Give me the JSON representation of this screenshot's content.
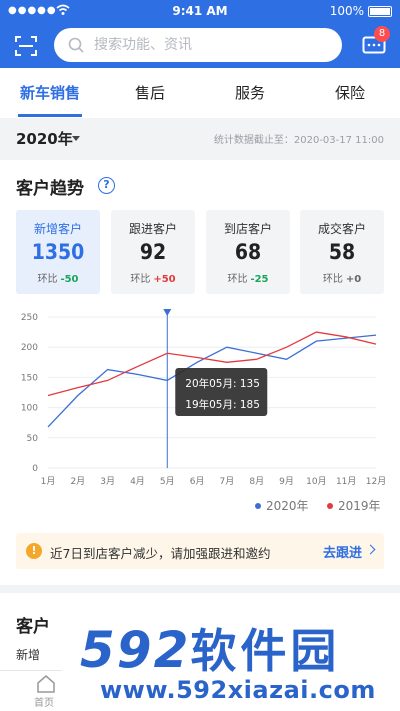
{
  "status_bar": {
    "carrier": "●●●●●",
    "time": "9:41 AM",
    "battery": "100%"
  },
  "header": {
    "search_placeholder": "搜索功能、资讯",
    "message_badge": "8"
  },
  "tabs": [
    {
      "label": "新车销售",
      "active": true
    },
    {
      "label": "售后",
      "active": false
    },
    {
      "label": "服务",
      "active": false
    },
    {
      "label": "保险",
      "active": false
    }
  ],
  "filter": {
    "year": "2020年",
    "stat_date": "统计数据截止至：2020-03-17 11:00"
  },
  "trend": {
    "title": "客户趋势",
    "help": "?",
    "kpis": [
      {
        "label": "新增客户",
        "value": "1350",
        "ratio_label": "环比",
        "delta": "-50",
        "delta_color": "green",
        "active": true
      },
      {
        "label": "跟进客户",
        "value": "92",
        "ratio_label": "环比",
        "delta": "+50",
        "delta_color": "red",
        "active": false
      },
      {
        "label": "到店客户",
        "value": "68",
        "ratio_label": "环比",
        "delta": "-25",
        "delta_color": "green",
        "active": false
      },
      {
        "label": "成交客户",
        "value": "58",
        "ratio_label": "环比",
        "delta": "+0",
        "delta_color": "gray",
        "active": false
      }
    ]
  },
  "chart_data": {
    "type": "line",
    "categories": [
      "1月",
      "2月",
      "3月",
      "4月",
      "5月",
      "6月",
      "7月",
      "8月",
      "9月",
      "10月",
      "11月",
      "12月"
    ],
    "ylim": [
      0,
      250
    ],
    "yticks": [
      0,
      50,
      100,
      150,
      200,
      250
    ],
    "series": [
      {
        "name": "2020年",
        "color": "#3b6fd6",
        "values": [
          68,
          120,
          163,
          155,
          145,
          175,
          200,
          190,
          180,
          210,
          215,
          220
        ]
      },
      {
        "name": "2019年",
        "color": "#e5393c",
        "values": [
          120,
          133,
          145,
          168,
          190,
          183,
          175,
          180,
          200,
          225,
          217,
          205
        ]
      }
    ],
    "highlight_index": 4,
    "tooltip": [
      "20年05月: 135",
      "19年05月: 185"
    ],
    "legend_position": "bottom-right"
  },
  "notice": {
    "text": "近7日到店客户减少，请加强跟进和邀约",
    "action": "去跟进"
  },
  "section2": {
    "title": "客户",
    "sub": "新增"
  },
  "bottom_nav": {
    "home": "首页"
  },
  "watermark": {
    "logo_digits": "592",
    "logo_cn": "软件园",
    "url": "www.592xiazai.com"
  }
}
